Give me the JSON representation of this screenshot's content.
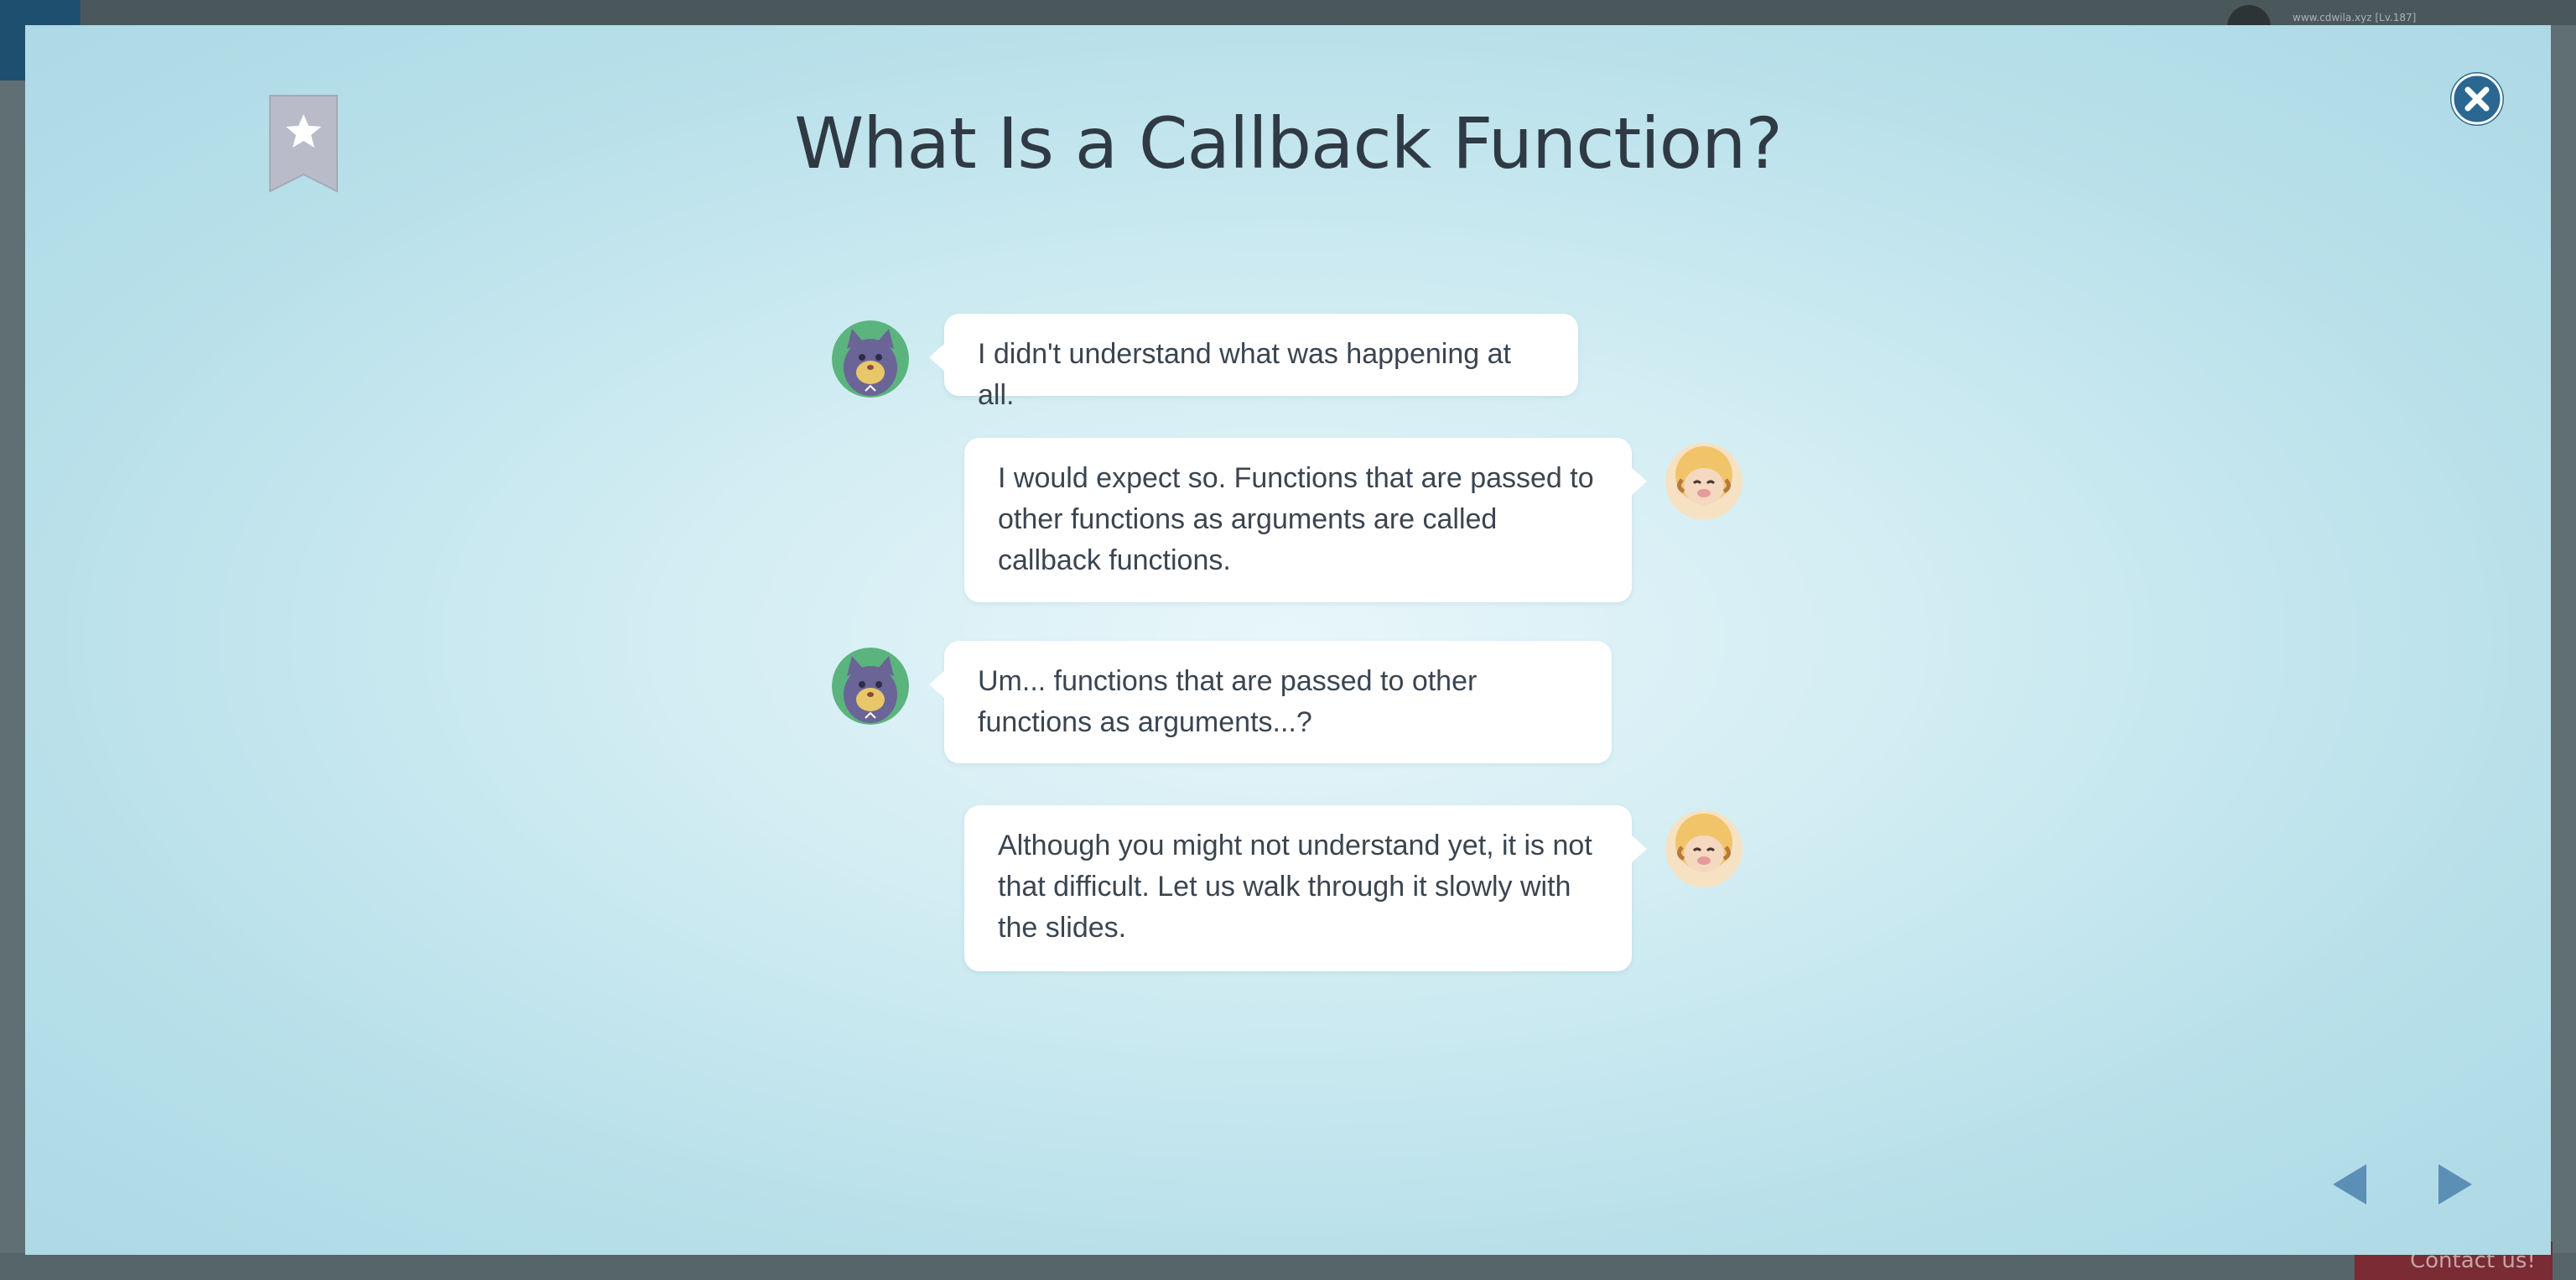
{
  "background": {
    "user_label": "www.cdwila.xyz [Lv.187]",
    "contact_label": "Contact us!"
  },
  "modal": {
    "title": "What Is a Callback Function?",
    "bookmark_icon": "star-bookmark-icon",
    "close_icon": "close-icon",
    "prev_icon": "triangle-left-icon",
    "next_icon": "triangle-right-icon",
    "colors": {
      "accent": "#2a6892",
      "nav": "#5b8fb5",
      "bubble": "#ffffff",
      "text": "#3a4550"
    }
  },
  "chat": {
    "messages": [
      {
        "speaker": "cat",
        "side": "left",
        "text": "I didn't understand what was happening at all."
      },
      {
        "speaker": "sheep",
        "side": "right",
        "text": "I would expect so. Functions that are passed to other functions as arguments are called callback functions."
      },
      {
        "speaker": "cat",
        "side": "left",
        "text": "Um... functions that are passed to other functions as arguments...?"
      },
      {
        "speaker": "sheep",
        "side": "right",
        "text": "Although you might not understand yet, it is not that difficult. Let us walk through it slowly with the slides."
      }
    ]
  }
}
